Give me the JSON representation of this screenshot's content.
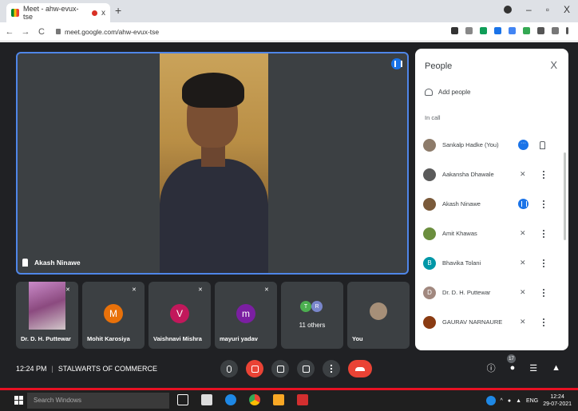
{
  "browser": {
    "tab_title": "Meet - ahw-evux-tse",
    "url": "meet.google.com/ahw-evux-tse",
    "close_symbol": "x",
    "newtab_symbol": "+",
    "back_symbol": "←",
    "forward_symbol": "→",
    "reload_symbol": "C",
    "minimize_symbol": "–",
    "restore_symbol": "▫",
    "window_close_symbol": "X"
  },
  "main_tile": {
    "name": "Akash Ninawe"
  },
  "thumbnails": [
    {
      "name": "Dr. D. H. Puttewar",
      "type": "photo"
    },
    {
      "name": "Mohit Karosiya",
      "initial": "M",
      "color": "#e8710a"
    },
    {
      "name": "Vaishnavi Mishra",
      "initial": "V",
      "color": "#c2185b"
    },
    {
      "name": "mayuri yadav",
      "initial": "m",
      "color": "#7b1fa2"
    },
    {
      "name": "11 others",
      "initials": [
        "T",
        "R"
      ],
      "colors": [
        "#4caf50",
        "#7986cb"
      ]
    },
    {
      "name": "You",
      "type": "photo"
    }
  ],
  "people_panel": {
    "title": "People",
    "close_symbol": "X",
    "add_people": "Add people",
    "section": "In call",
    "participants": [
      {
        "name": "Sankalp Hadke (You)",
        "avatar": "photo",
        "color": "#8d7b6a",
        "status": "more"
      },
      {
        "name": "Aakansha Dhawale",
        "avatar": "photo",
        "color": "#5a5a5a",
        "status": "muted"
      },
      {
        "name": "Akash Ninawe",
        "avatar": "photo",
        "color": "#7a5a3a",
        "status": "speaking"
      },
      {
        "name": "Amit Khawas",
        "avatar": "photo",
        "color": "#6b8e3e",
        "status": "muted"
      },
      {
        "name": "Bhavika Tolani",
        "initial": "B",
        "color": "#0097a7",
        "status": "muted"
      },
      {
        "name": "Dr. D. H. Puttewar",
        "initial": "D",
        "color": "#a1887f",
        "status": "muted"
      },
      {
        "name": "GAURAV NARNAURE",
        "avatar": "photo",
        "color": "#8a3b12",
        "status": "muted"
      }
    ]
  },
  "bottom_bar": {
    "time": "12:24 PM",
    "separator": "|",
    "meeting_name": "STALWARTS OF COMMERCE",
    "participant_count": "17",
    "info_symbol": "ⓘ",
    "chat_symbol": "☰",
    "activities_symbol": "▲"
  },
  "taskbar": {
    "search_placeholder": "Search Windows",
    "lang": "ENG",
    "time": "12:24",
    "date": "29-07-2021"
  }
}
